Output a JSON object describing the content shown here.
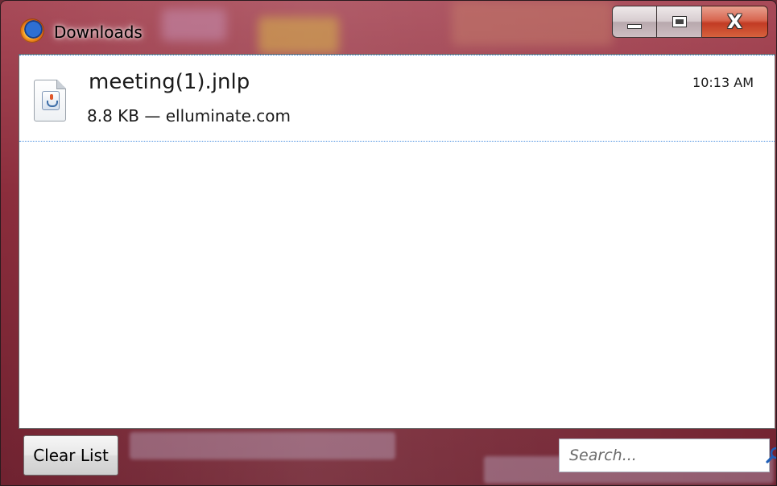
{
  "window": {
    "title": "Downloads",
    "icon": "firefox-icon",
    "caption_buttons": {
      "minimize": "minimize-icon",
      "maximize": "maximize-icon",
      "close_label": "X"
    }
  },
  "downloads": [
    {
      "name": "meeting(1).jnlp",
      "details": "8.8 KB — elluminate.com",
      "time": "10:13 AM",
      "icon": "java-file-icon"
    }
  ],
  "footer": {
    "clear_button_label": "Clear List",
    "search_placeholder": "Search...",
    "search_icon": "search-icon"
  },
  "colors": {
    "glass": "#8b2d3c",
    "selection_border": "#4a8fe0",
    "close_button": "#c23b24"
  }
}
